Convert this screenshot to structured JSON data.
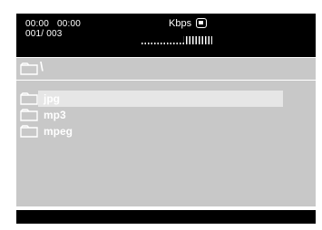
{
  "header": {
    "time_current": "00:00",
    "time_total": "00:00",
    "track": "001/ 003",
    "bitrate_label": "Kbps",
    "stop_icon": "stop-icon"
  },
  "path": {
    "text": "\\",
    "icon": "folder-icon"
  },
  "files": [
    {
      "name": "jpg",
      "icon": "folder-icon",
      "selected": true
    },
    {
      "name": "mp3",
      "icon": "folder-icon",
      "selected": false
    },
    {
      "name": "mpeg",
      "icon": "folder-icon",
      "selected": false
    }
  ],
  "colors": {
    "panel": "#c8c8c8",
    "highlight": "#e6e6e6",
    "bar": "#000000",
    "text": "#ffffff"
  }
}
